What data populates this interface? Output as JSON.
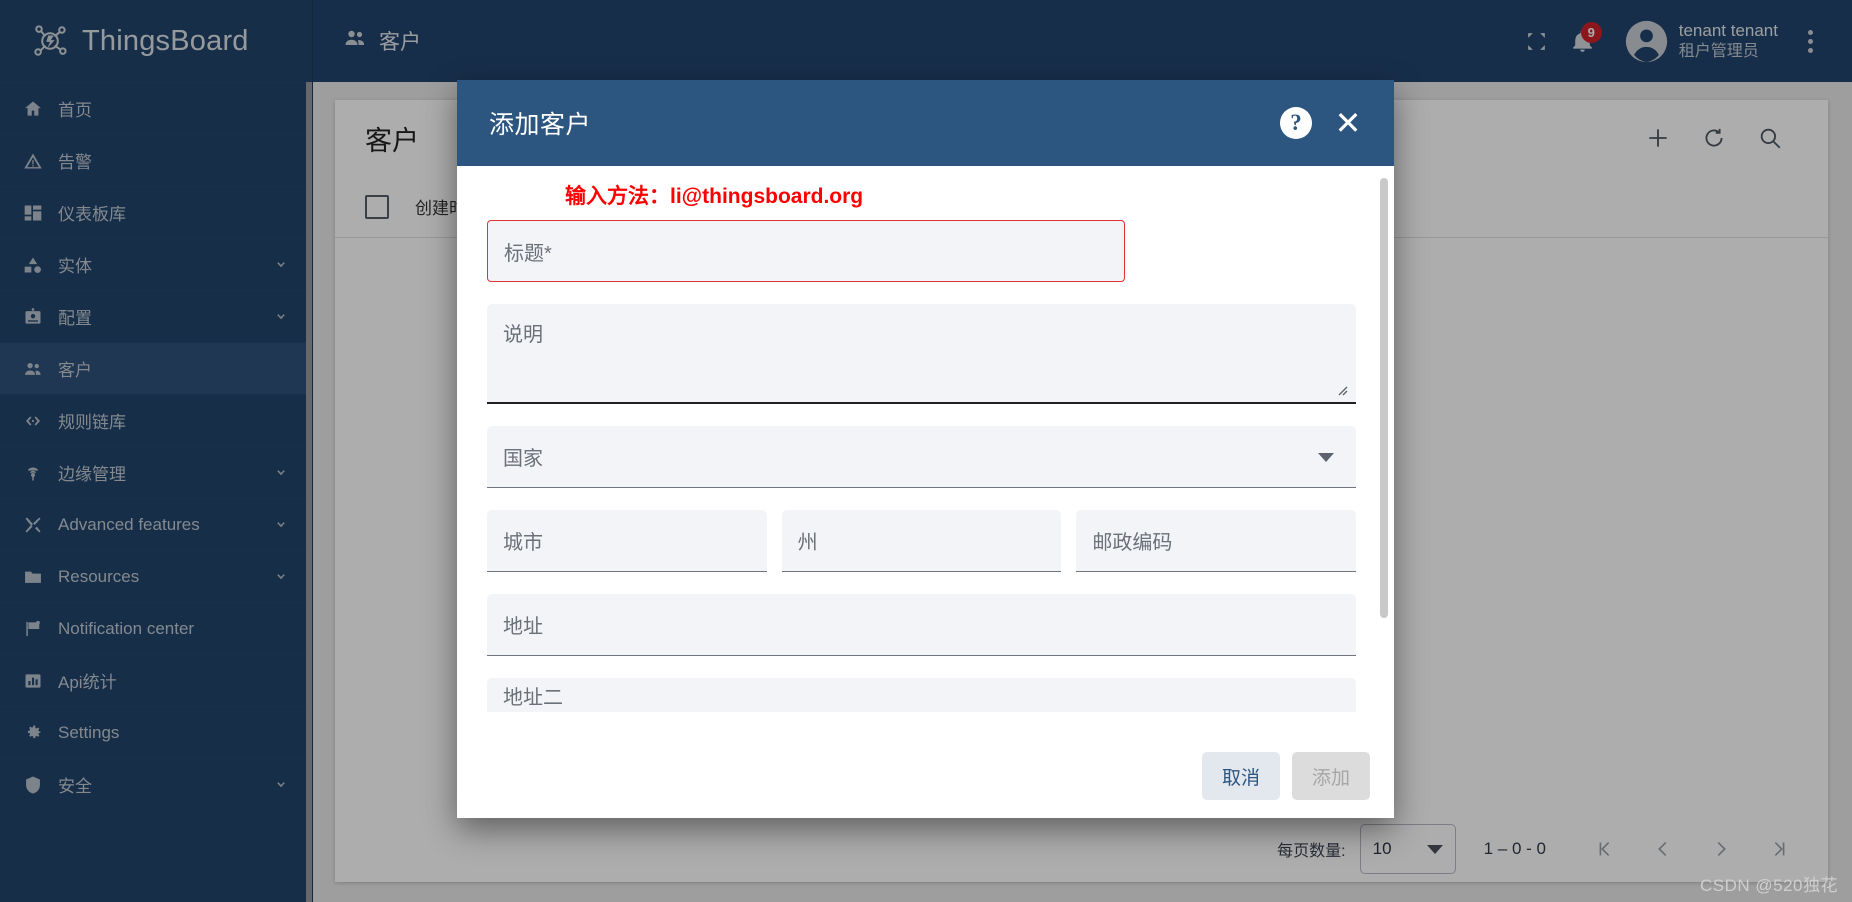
{
  "brand": {
    "name": "ThingsBoard",
    "logo_icon": "thingsboard-logo-icon"
  },
  "sidebar": {
    "items": [
      {
        "label": "首页",
        "icon": "home-icon",
        "expandable": false,
        "active": false
      },
      {
        "label": "告警",
        "icon": "alarm-warning-icon",
        "expandable": false,
        "active": false
      },
      {
        "label": "仪表板库",
        "icon": "dashboard-grid-icon",
        "expandable": false,
        "active": false
      },
      {
        "label": "实体",
        "icon": "entity-shapes-icon",
        "expandable": true,
        "active": false
      },
      {
        "label": "配置",
        "icon": "profile-card-icon",
        "expandable": true,
        "active": false
      },
      {
        "label": "客户",
        "icon": "customers-people-icon",
        "expandable": false,
        "active": true
      },
      {
        "label": "规则链库",
        "icon": "rule-chain-icon",
        "expandable": false,
        "active": false
      },
      {
        "label": "边缘管理",
        "icon": "edge-antenna-icon",
        "expandable": true,
        "active": false
      },
      {
        "label": "Advanced features",
        "icon": "tools-icon",
        "expandable": true,
        "active": false
      },
      {
        "label": "Resources",
        "icon": "folder-icon",
        "expandable": true,
        "active": false
      },
      {
        "label": "Notification center",
        "icon": "flag-icon",
        "expandable": false,
        "active": false
      },
      {
        "label": "Api统计",
        "icon": "bar-chart-icon",
        "expandable": false,
        "active": false
      },
      {
        "label": "Settings",
        "icon": "gear-icon",
        "expandable": false,
        "active": false
      },
      {
        "label": "安全",
        "icon": "shield-icon",
        "expandable": true,
        "active": false
      }
    ]
  },
  "topbar": {
    "title": "客户",
    "title_icon": "customers-people-icon",
    "fullscreen_icon": "fullscreen-icon",
    "notifications_icon": "bell-icon",
    "notifications_count": "9",
    "avatar_icon": "account-circle-icon",
    "user_name": "tenant tenant",
    "user_role": "租户管理员",
    "more_icon": "kebab-menu-icon"
  },
  "page": {
    "title": "客户",
    "toolbar": {
      "add_icon": "plus-icon",
      "refresh_icon": "refresh-icon",
      "search_icon": "search-icon"
    },
    "table": {
      "select_all_checkbox": "",
      "columns": [
        "创建时间"
      ]
    },
    "paginator": {
      "items_per_page_label": "每页数量:",
      "page_size": "10",
      "range_label": "1 – 0 - 0",
      "first_icon": "first-page-icon",
      "prev_icon": "previous-page-icon",
      "next_icon": "next-page-icon",
      "last_icon": "last-page-icon"
    }
  },
  "dialog": {
    "title": "添加客户",
    "help_icon": "help-icon",
    "help_label": "?",
    "close_icon": "close-icon",
    "close_label": "✕",
    "annotation": "输入方法：li@thingsboard.org",
    "fields": {
      "title": {
        "placeholder": "标题*",
        "value": "",
        "invalid": true
      },
      "description": {
        "placeholder": "说明",
        "value": ""
      },
      "country": {
        "placeholder": "国家",
        "value": ""
      },
      "city": {
        "placeholder": "城市",
        "value": ""
      },
      "state": {
        "placeholder": "州",
        "value": ""
      },
      "zip": {
        "placeholder": "邮政编码",
        "value": ""
      },
      "address": {
        "placeholder": "地址",
        "value": ""
      },
      "address2": {
        "placeholder": "地址二",
        "value": ""
      }
    },
    "buttons": {
      "cancel": "取消",
      "submit": "添加"
    }
  },
  "watermark": "CSDN @520独花",
  "colors": {
    "sidebar_bg": "#21446b",
    "topbar_bg": "#22456d",
    "dialog_header_bg": "#2c557f",
    "accent": "#2f5580",
    "error": "#ff0000",
    "badge": "#cf2128"
  }
}
